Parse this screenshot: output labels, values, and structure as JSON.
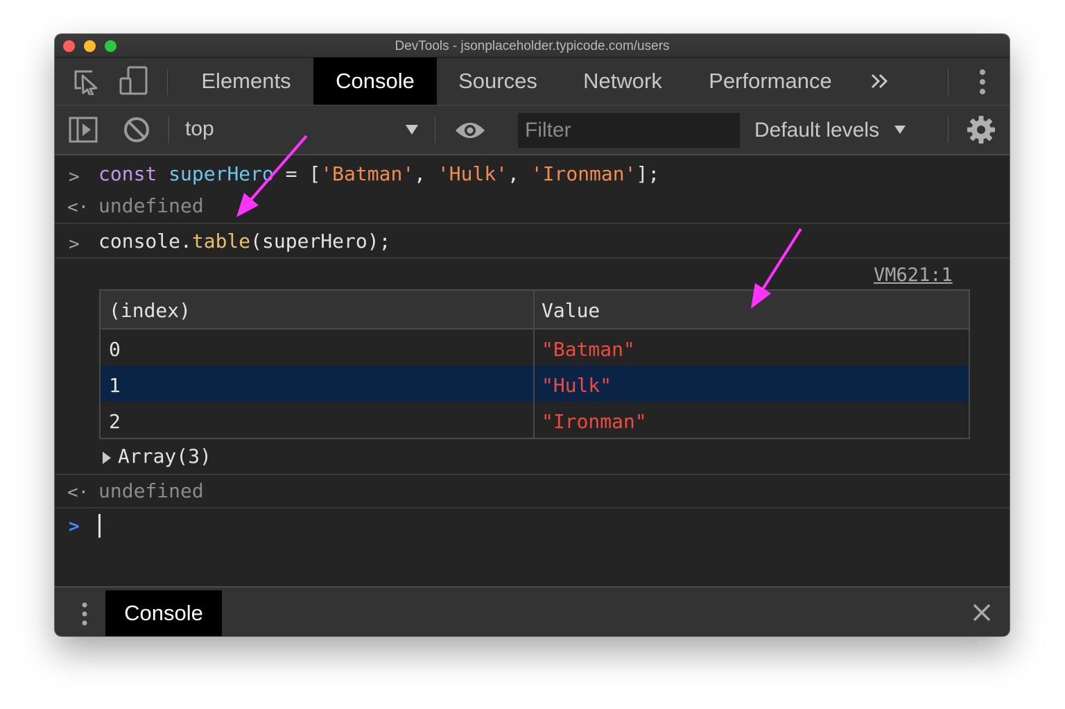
{
  "window": {
    "title": "DevTools - jsonplaceholder.typicode.com/users"
  },
  "tabs": [
    {
      "label": "Elements",
      "active": false
    },
    {
      "label": "Console",
      "active": true
    },
    {
      "label": "Sources",
      "active": false
    },
    {
      "label": "Network",
      "active": false
    },
    {
      "label": "Performance",
      "active": false
    }
  ],
  "toolbar": {
    "context": "top",
    "filter_placeholder": "Filter",
    "levels": "Default levels"
  },
  "console": {
    "entry1": {
      "kw": "const",
      "var": "superHero",
      "mid": " = [",
      "s1": "'Batman'",
      "c1": ", ",
      "s2": "'Hulk'",
      "c2": ", ",
      "s3": "'Ironman'",
      "end": "];"
    },
    "result1": "undefined",
    "entry2": {
      "obj": "console.",
      "fn": "table",
      "args": "(superHero);"
    },
    "source_link": "VM621:1",
    "table": {
      "headers": [
        "(index)",
        "Value"
      ],
      "rows": [
        {
          "index": "0",
          "value": "\"Batman\"",
          "selected": false
        },
        {
          "index": "1",
          "value": "\"Hulk\"",
          "selected": true
        },
        {
          "index": "2",
          "value": "\"Ironman\"",
          "selected": false
        }
      ]
    },
    "array_summary": "Array(3)",
    "result2": "undefined"
  },
  "drawer": {
    "tab": "Console"
  },
  "colors": {
    "annotation_arrow": "#ff33ff",
    "selected_row": "#0b2446",
    "string": "#ee4b40"
  }
}
